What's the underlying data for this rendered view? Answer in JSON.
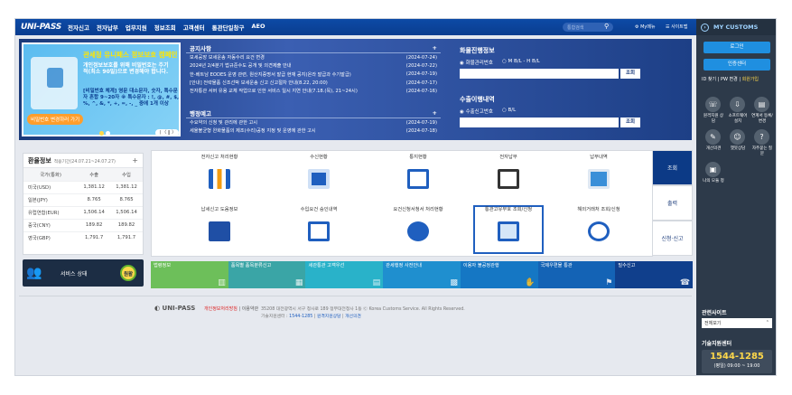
{
  "header": {
    "logo": "UNI-PASS",
    "nav": [
      "전자신고",
      "전자납부",
      "업무지원",
      "정보조회",
      "고객센터",
      "통관단일창구",
      "AEO"
    ],
    "search_placeholder": "통합검색",
    "my_menu": "My메뉴",
    "sitemap": "사이트맵"
  },
  "my_customs": {
    "title": "MY CUSTOMS",
    "login_button": "로그인",
    "cert_button": "인증센터",
    "links": [
      "ID 찾기",
      "PW 변경",
      "회원가입"
    ],
    "quick_items": [
      {
        "label": "원격지원 상담",
        "icon": "headset-icon"
      },
      {
        "label": "소프트웨어 설치",
        "icon": "download-icon"
      },
      {
        "label": "연계서 등록/변경",
        "icon": "document-icon"
      },
      {
        "label": "개선의견",
        "icon": "chat-icon"
      },
      {
        "label": "챗봇상담",
        "icon": "bot-icon"
      },
      {
        "label": "자주묻는 질문",
        "icon": "question-icon"
      },
      {
        "label": "나의 모듈 정",
        "icon": "module-icon"
      }
    ],
    "related_title": "관련사이트",
    "related_select": "전체보기",
    "callcenter_title": "기술지원센터",
    "callcenter_phone": "1544-1285",
    "callcenter_hours": "(평일) 09:00 ~ 19:00"
  },
  "banner": {
    "title": "관세청 유니패스 정보보호 캠페인",
    "text": "개인정보보호를 위해 비밀번호는 주기적(최소 90일)으로 변경해야 합니다.",
    "sub": "[비밀번호 체계] 영문 대소문자, 숫자, 특수문자 혼합 9~20자 ※ 특수문자 : !, @, #, $, %, ^, &, *, +, =, -, _ 중에 1개 이상",
    "button": "비밀번호 변경하러 가기",
    "nav": "ㅣ〈 ‖ 〉"
  },
  "notices": {
    "title": "공지사항",
    "items": [
      {
        "text": "보세공장 보세운송 자동수리 요건 변경",
        "date": "(2024-07-24)"
      },
      {
        "text": "2024년 2/4분기 법규준수도 공개 및 의견제출 안내",
        "date": "(2024-07-22)"
      },
      {
        "text": "한-베트남 EODES 운영 관련, 원산지증명서 발급 현재 공지(온라 발급과 수기발급)",
        "date": "(2024-07-19)"
      },
      {
        "text": "[안내] 전략물품 신조선박 보세운송 신고 신고절차 안내(8.22, 20:00)",
        "date": "(2024-07-17)"
      },
      {
        "text": "전자통관 서버 유용 교체 작업으로 인한 서비스 일시 지연 안내(7.18.(목), 21~24시)",
        "date": "(2024-07-16)"
      }
    ]
  },
  "admin_notices": {
    "title": "행정예고",
    "items": [
      {
        "text": "수요약의 신청 및 관리에 관한 고시",
        "date": "(2024-07-19)"
      },
      {
        "text": "세율불균형 완화물품의 제조(수리)공정 지정 및 운영에 관한 고시",
        "date": "(2024-07-18)"
      }
    ]
  },
  "cargo_tracking": {
    "title": "화물진행정보",
    "options": [
      "화물관리번호",
      "M B/L - H B/L"
    ],
    "button": "조회"
  },
  "export_tracking": {
    "title": "수출이행내역",
    "options": [
      "수출신고번호",
      "B/L"
    ],
    "button": "조회"
  },
  "exchange_rate": {
    "title": "환율정보",
    "period": "적용기간(24.07.21~24.07.27)",
    "headers": [
      "국가(통화)",
      "수출",
      "수입"
    ],
    "rows": [
      [
        "미국(USD)",
        "1,381.12",
        "1,381.12"
      ],
      [
        "일본(JPY)",
        "8.765",
        "8.765"
      ],
      [
        "유럽연합(EUR)",
        "1,506.14",
        "1,506.14"
      ],
      [
        "중국(CNY)",
        "189.82",
        "189.82"
      ],
      [
        "영국(GBP)",
        "1,791.7",
        "1,791.7"
      ]
    ]
  },
  "system_status": {
    "label": "서비스 상태",
    "badge": "원활"
  },
  "services": [
    {
      "label": "전자신고 처리현황"
    },
    {
      "label": "수신현황"
    },
    {
      "label": "통지현황"
    },
    {
      "label": "전자납부"
    },
    {
      "label": "납부내역"
    },
    {
      "label": "납세신고 도움정보"
    },
    {
      "label": "수입요건 승인내역"
    },
    {
      "label": "요건신청서청서 처리현황"
    },
    {
      "label": "통관고유부호 조회/신청"
    },
    {
      "label": "해외거래처 조회/신청"
    }
  ],
  "service_tabs": [
    "조회",
    "출력",
    "신청·신고"
  ],
  "shortcuts": [
    {
      "label": "법령정보",
      "color": "#6dbf5a"
    },
    {
      "label": "품목별 품목분류신고",
      "color": "#3aa5a6"
    },
    {
      "label": "세관통관 고객우선",
      "color": "#29b2c9"
    },
    {
      "label": "관세행정 사전안내",
      "color": "#1f8fcf"
    },
    {
      "label": "이용자 불공정관행",
      "color": "#1577c4"
    },
    {
      "label": "국제우편물 통관",
      "color": "#1463b5"
    },
    {
      "label": "밀수신고",
      "color": "#103f8c"
    }
  ],
  "footer": {
    "logo": "UNI-PASS",
    "privacy": "개인정보처리방침",
    "terms": "이용약관",
    "address": "35208 대전광역시 서구 청사로 189 정부대전청사 1동 Ⓒ Korea Customs Service. All Rights Reserved.",
    "phone_label": "기술지원센터 :",
    "phone": "1544-1285",
    "link1": "원격지원상담",
    "link2": "개선의견"
  },
  "colors": {
    "header_blue": "#0d4aa6",
    "panel_dark": "#2d3a4a",
    "accent_blue": "#1f8fe0",
    "tab_active": "#0c3a86"
  }
}
